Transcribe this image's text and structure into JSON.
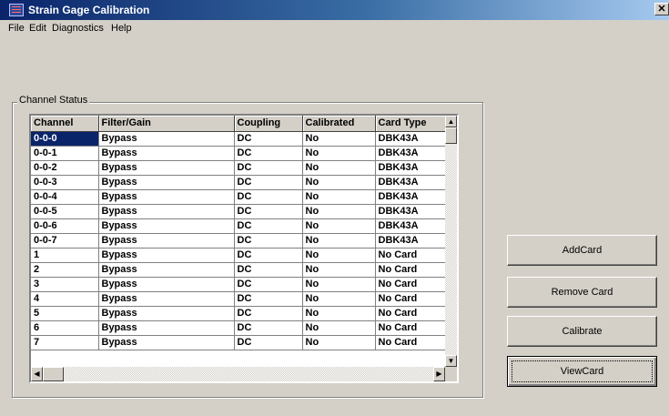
{
  "window": {
    "title": "Strain Gage Calibration",
    "close_glyph": "✕"
  },
  "menu": [
    {
      "label": "File"
    },
    {
      "label": "Edit"
    },
    {
      "label": "Diagnostics"
    },
    {
      "label": "Help"
    }
  ],
  "channel_status": {
    "group_label": "Channel Status",
    "columns": [
      "Channel",
      "Filter/Gain",
      "Coupling",
      "Calibrated",
      "Card Type"
    ],
    "rows": [
      [
        "0-0-0",
        "Bypass",
        "DC",
        "No",
        "DBK43A"
      ],
      [
        "0-0-1",
        "Bypass",
        "DC",
        "No",
        "DBK43A"
      ],
      [
        "0-0-2",
        "Bypass",
        "DC",
        "No",
        "DBK43A"
      ],
      [
        "0-0-3",
        "Bypass",
        "DC",
        "No",
        "DBK43A"
      ],
      [
        "0-0-4",
        "Bypass",
        "DC",
        "No",
        "DBK43A"
      ],
      [
        "0-0-5",
        "Bypass",
        "DC",
        "No",
        "DBK43A"
      ],
      [
        "0-0-6",
        "Bypass",
        "DC",
        "No",
        "DBK43A"
      ],
      [
        "0-0-7",
        "Bypass",
        "DC",
        "No",
        "DBK43A"
      ],
      [
        "1",
        "Bypass",
        "DC",
        "No",
        "No Card"
      ],
      [
        "2",
        "Bypass",
        "DC",
        "No",
        "No Card"
      ],
      [
        "3",
        "Bypass",
        "DC",
        "No",
        "No Card"
      ],
      [
        "4",
        "Bypass",
        "DC",
        "No",
        "No Card"
      ],
      [
        "5",
        "Bypass",
        "DC",
        "No",
        "No Card"
      ],
      [
        "6",
        "Bypass",
        "DC",
        "No",
        "No Card"
      ],
      [
        "7",
        "Bypass",
        "DC",
        "No",
        "No Card"
      ]
    ],
    "selected_cell": "0-0-0",
    "scroll_glyphs": {
      "up": "▲",
      "down": "▼",
      "left": "◀",
      "right": "▶"
    }
  },
  "buttons": {
    "add_card": "AddCard",
    "remove_card": "Remove Card",
    "calibrate": "Calibrate",
    "view_card": "ViewCard"
  },
  "colors": {
    "title_bar": "#0a246a",
    "selection": "#0a246a",
    "face": "#d4d0c8"
  }
}
